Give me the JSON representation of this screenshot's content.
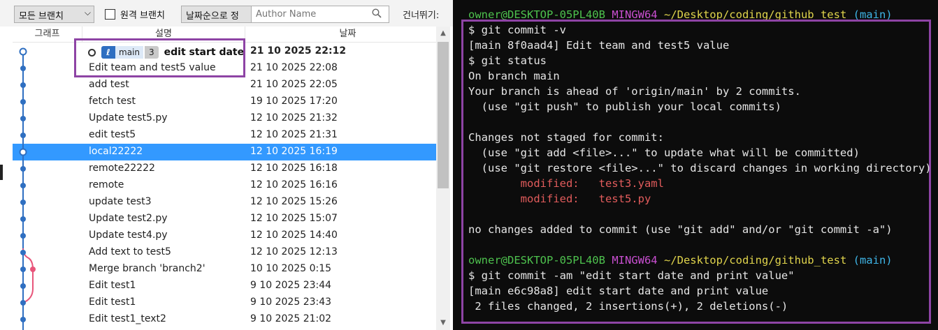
{
  "toolbar": {
    "branch_select": "모든 브랜치",
    "remote_branch_label": "원격 브랜치",
    "sort_select": "날짜순으로 정",
    "author_placeholder": "Author Name",
    "goto_label": "건너뛰기:"
  },
  "columns": {
    "graph": "그래프",
    "description": "설명",
    "date": "날짜"
  },
  "head_commit": {
    "branch": "main",
    "ahead": "3",
    "description": "edit start date",
    "date": "21 10 2025 22:12"
  },
  "commits": [
    {
      "description": "Edit team and test5 value",
      "date": "21 10 2025 22:08"
    },
    {
      "description": "add test",
      "date": "21 10 2025 22:05"
    },
    {
      "description": "fetch test",
      "date": "19 10 2025 17:20"
    },
    {
      "description": "Update test5.py",
      "date": "12 10 2025 21:32"
    },
    {
      "description": "edit test5",
      "date": "12 10 2025 21:31"
    },
    {
      "description": "local22222",
      "date": "12 10 2025 16:19"
    },
    {
      "description": "remote22222",
      "date": "12 10 2025 16:18"
    },
    {
      "description": "remote",
      "date": "12 10 2025 16:16"
    },
    {
      "description": "update test3",
      "date": "12 10 2025 15:26"
    },
    {
      "description": "Update test2.py",
      "date": "12 10 2025 15:07"
    },
    {
      "description": "Update test4.py",
      "date": "12 10 2025 14:40"
    },
    {
      "description": "Add text to test5",
      "date": "12 10 2025 12:13"
    },
    {
      "description": "Merge branch 'branch2'",
      "date": "10 10 2025 0:15"
    },
    {
      "description": "Edit test1",
      "date": "9 10 2025 23:44"
    },
    {
      "description": "Edit test1",
      "date": "9 10 2025 23:43"
    },
    {
      "description": "Edit test1_text2",
      "date": "9 10 2025 21:02"
    }
  ],
  "selected_commit_index": 5,
  "colors": {
    "graph_main": "#2f6fc1",
    "graph_branch": "#e8557a",
    "selection": "#3399ff",
    "highlight_box": "#8e44a5"
  },
  "terminal": {
    "prompt1": {
      "user": "owner@DESKTOP-05PL40B",
      "shell": "MINGW64",
      "path": "~/Desktop/coding/github_test",
      "branch": "(main)"
    },
    "lines": [
      "$ git commit -v",
      "[main 8f0aad4] Edit team and test5 value",
      "$ git status",
      "On branch main",
      "Your branch is ahead of 'origin/main' by 2 commits.",
      "  (use \"git push\" to publish your local commits)",
      "",
      "Changes not staged for commit:",
      "  (use \"git add <file>...\" to update what will be committed)",
      "  (use \"git restore <file>...\" to discard changes in working directory)"
    ],
    "modified": [
      {
        "label": "        modified:   ",
        "file": "test3.yaml"
      },
      {
        "label": "        modified:   ",
        "file": "test5.py"
      }
    ],
    "no_changes": "no changes added to commit (use \"git add\" and/or \"git commit -a\")",
    "prompt2": {
      "user": "owner@DESKTOP-05PL40B",
      "shell": "MINGW64",
      "path": "~/Desktop/coding/github_test",
      "branch": "(main)"
    },
    "tail_lines": [
      "$ git commit -am \"edit start date and print value\"",
      "[main e6c98a8] edit start date and print value",
      " 2 files changed, 2 insertions(+), 2 deletions(-)"
    ]
  }
}
